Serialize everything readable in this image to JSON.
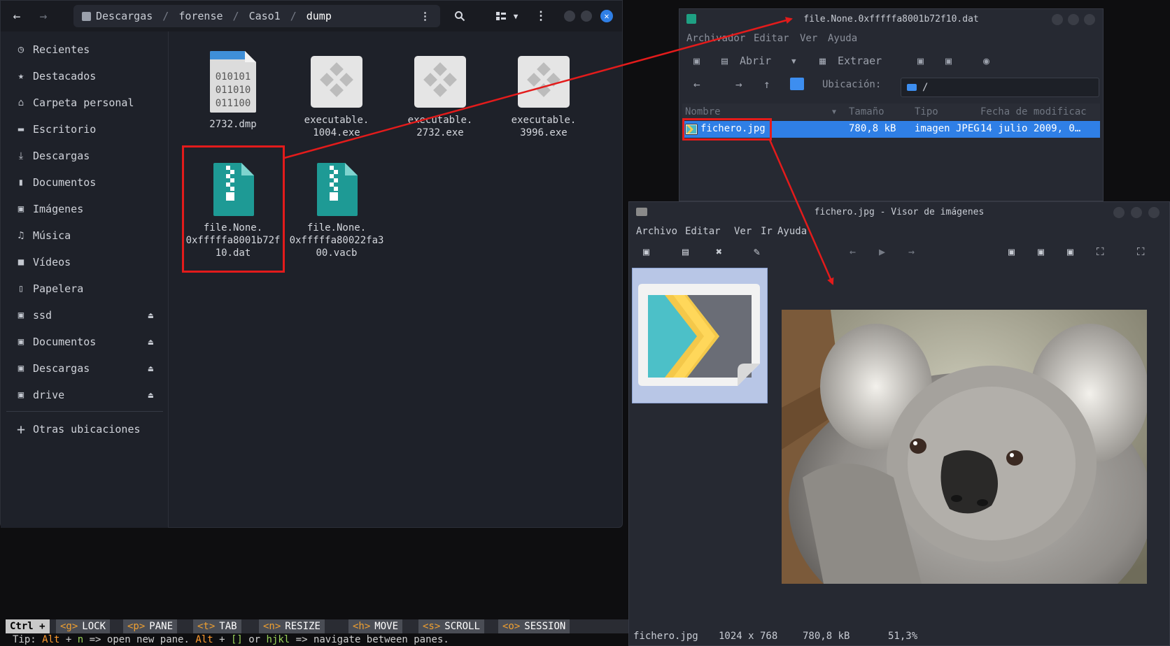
{
  "file_manager": {
    "path": [
      "Descargas",
      "forense",
      "Caso1",
      "dump"
    ],
    "sidebar": [
      {
        "icon": "clock-icon",
        "glyph": "◷",
        "label": "Recientes"
      },
      {
        "icon": "star-icon",
        "glyph": "★",
        "label": "Destacados"
      },
      {
        "icon": "home-icon",
        "glyph": "⌂",
        "label": "Carpeta personal"
      },
      {
        "icon": "desktop-icon",
        "glyph": "▬",
        "label": "Escritorio"
      },
      {
        "icon": "download-icon",
        "glyph": "⤓",
        "label": "Descargas"
      },
      {
        "icon": "document-icon",
        "glyph": "▮",
        "label": "Documentos"
      },
      {
        "icon": "image-icon",
        "glyph": "▣",
        "label": "Imágenes"
      },
      {
        "icon": "music-icon",
        "glyph": "♫",
        "label": "Música"
      },
      {
        "icon": "video-icon",
        "glyph": "■",
        "label": "Vídeos"
      },
      {
        "icon": "trash-icon",
        "glyph": "▯",
        "label": "Papelera"
      },
      {
        "icon": "drive-icon",
        "glyph": "▣",
        "label": "ssd",
        "eject": true
      },
      {
        "icon": "drive-icon",
        "glyph": "▣",
        "label": "Documentos",
        "eject": true
      },
      {
        "icon": "drive-icon",
        "glyph": "▣",
        "label": "Descargas",
        "eject": true
      },
      {
        "icon": "drive-icon",
        "glyph": "▣",
        "label": "drive",
        "eject": true
      }
    ],
    "other_locations": "Otras ubicaciones",
    "files": {
      "dmp": "2732.dmp",
      "exe1": "executable.\n1004.exe",
      "exe2": "executable.\n2732.exe",
      "exe3": "executable.\n3996.exe",
      "dat": "file.None.\n0xfffffa8001b72f\n10.dat",
      "vacb": "file.None.\n0xfffffa80022fa3\n00.vacb"
    },
    "binary_lines": [
      "010101",
      "011010",
      "011100"
    ]
  },
  "archive": {
    "title": "file.None.0xfffffa8001b72f10.dat",
    "menu": [
      "Archivador",
      "Editar",
      "Ver",
      "Ayuda"
    ],
    "open_label": "Abrir",
    "extract_label": "Extraer",
    "location_label": "Ubicación:",
    "location_value": "/",
    "columns": [
      "Nombre",
      "Tamaño",
      "Tipo",
      "Fecha de modificac"
    ],
    "row": {
      "name": "fichero.jpg",
      "size": "780,8 kB",
      "type": "imagen JPEG",
      "date": "14 julio 2009, 0…"
    }
  },
  "viewer": {
    "title": "fichero.jpg - Visor de imágenes",
    "menu": [
      "Archivo",
      "Editar",
      "Ver",
      "Ir",
      "Ayuda"
    ],
    "status": {
      "name": "fichero.jpg",
      "dims": "1024 x 768",
      "size": "780,8 kB",
      "zoom": "51,3%"
    }
  },
  "terminal": {
    "ctrl": "Ctrl +",
    "segments": [
      {
        "key": "<g>",
        "label": "LOCK"
      },
      {
        "key": "<p>",
        "label": "PANE"
      },
      {
        "key": "<t>",
        "label": "TAB"
      },
      {
        "key": "<n>",
        "label": "RESIZE"
      },
      {
        "key": "<h>",
        "label": "MOVE"
      },
      {
        "key": "<s>",
        "label": "SCROLL"
      },
      {
        "key": "<o>",
        "label": "SESSION"
      }
    ],
    "tip": {
      "prefix": "Tip: ",
      "alt1": "Alt",
      "plus1": " + ",
      "n": "n",
      "mid": " => open new pane. ",
      "alt2": "Alt",
      "plus2": " + ",
      "brackets": "[]",
      "or": " or ",
      "hjkl": "hjkl",
      "end": " => navigate between panes."
    }
  }
}
